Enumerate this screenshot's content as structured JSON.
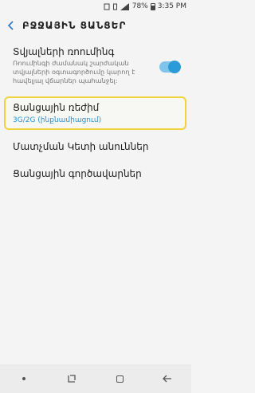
{
  "status_bar": {
    "battery_percent": "78%",
    "time": "3:35 PM"
  },
  "app_bar": {
    "title": "ԲՋՋԱՅԻՆ ՑԱՆՑԵՐ"
  },
  "settings": [
    {
      "title": "Տվյալների ռոումինգ",
      "description": "Ռոումինգի ժամանակ շարժական տվյալների օգտագործումը կարող է հավելյալ վճարներ պահանջել:",
      "toggle_on": true
    },
    {
      "title": "Ցանցային ռեժիմ",
      "value": "3G/2G (ինքնամիացում)"
    },
    {
      "title": "Մատչման Կետի անուններ"
    },
    {
      "title": "Ցանցային գործավարներ"
    }
  ],
  "colors": {
    "accent": "#2b78c5",
    "toggle": "#2b9ad8",
    "highlight_border": "#f0d23a"
  },
  "icons": {
    "back": "chevron-left-icon",
    "nav_recents": "dot-icon",
    "nav_home": "square-icon",
    "nav_back": "arrow-left-icon"
  }
}
